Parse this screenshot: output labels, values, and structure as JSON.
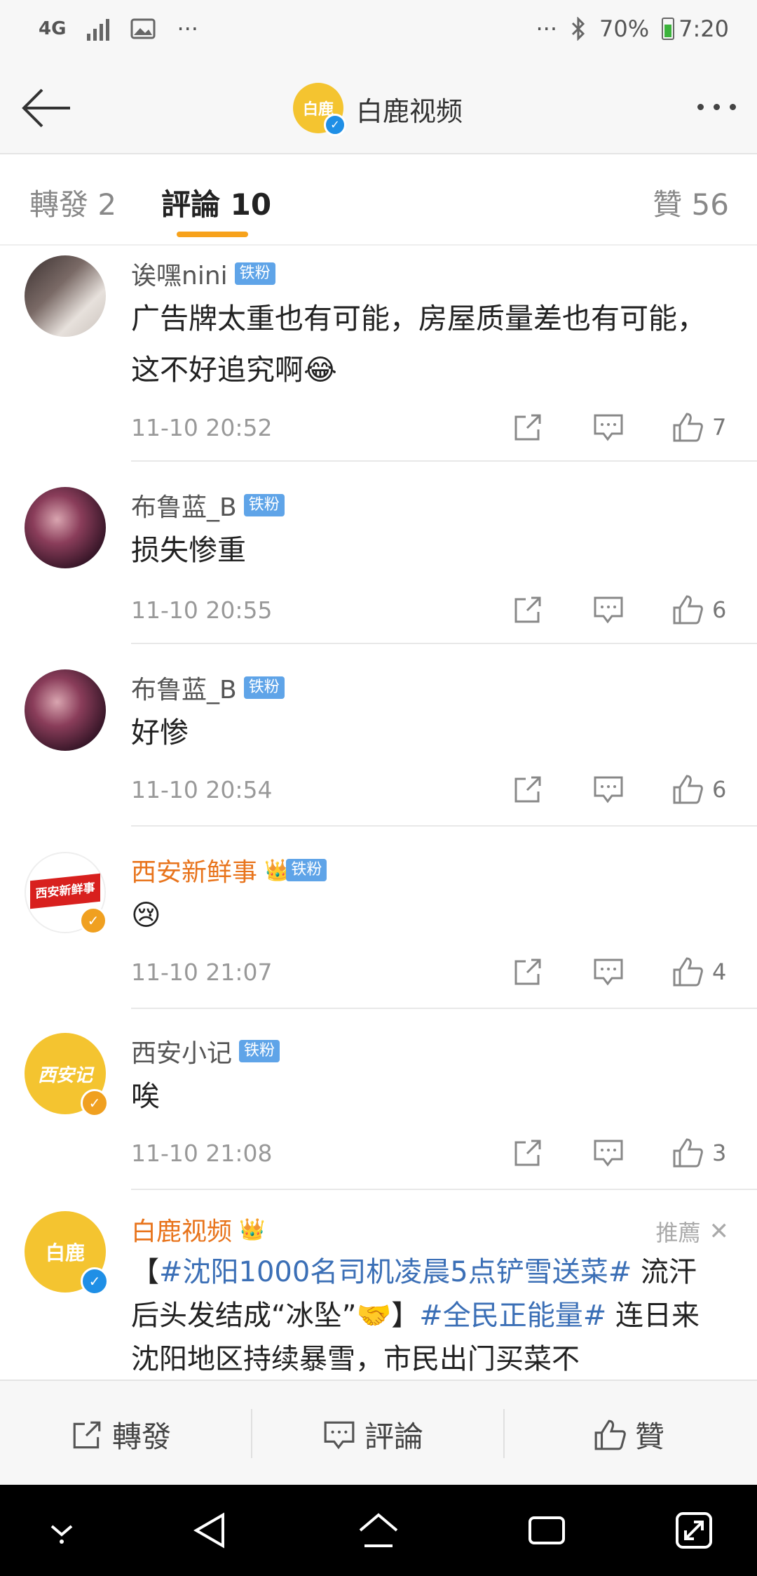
{
  "status_bar": {
    "network": "4G",
    "battery": "70%",
    "time": "7:20",
    "dots": "···"
  },
  "header": {
    "title": "白鹿视频",
    "avatar_text": "白鹿"
  },
  "tabs": {
    "forward": "轉發 2",
    "comment": "評論 10",
    "like": "贊 56"
  },
  "comments": [
    {
      "name": "诶嘿nini",
      "badge": "铁粉",
      "text": "广告牌太重也有可能，房屋质量差也有可能，这不好追究啊😂",
      "time": "11-10 20:52",
      "likes": "7"
    },
    {
      "name": "布鲁蓝_B",
      "badge": "铁粉",
      "text": "损失惨重",
      "time": "11-10 20:55",
      "likes": "6"
    },
    {
      "name": "布鲁蓝_B",
      "badge": "铁粉",
      "text": "好惨",
      "time": "11-10 20:54",
      "likes": "6"
    },
    {
      "name": "西安新鲜事",
      "badge": "铁粉",
      "avatar_text": "西安新鲜事",
      "text": "😢",
      "time": "11-10 21:07",
      "likes": "4"
    },
    {
      "name": "西安小记",
      "badge": "铁粉",
      "avatar_text": "西安记",
      "text": "唉",
      "time": "11-10 21:08",
      "likes": "3"
    }
  ],
  "recommended": {
    "name": "白鹿视频",
    "avatar_text": "白鹿",
    "label": "推薦",
    "close": "✕",
    "text_pre": "【",
    "hashtag1": "#沈阳1000名司机凌晨5点铲雪送菜#",
    "text_mid": " 流汗后头发结成“冰坠”🤝】",
    "hashtag2": "#全民正能量#",
    "text_post": " 连日来沈阳地区持续暴雪，市民出门买菜不"
  },
  "bottom_bar": {
    "forward": "轉發",
    "comment": "評論",
    "like": "贊"
  }
}
